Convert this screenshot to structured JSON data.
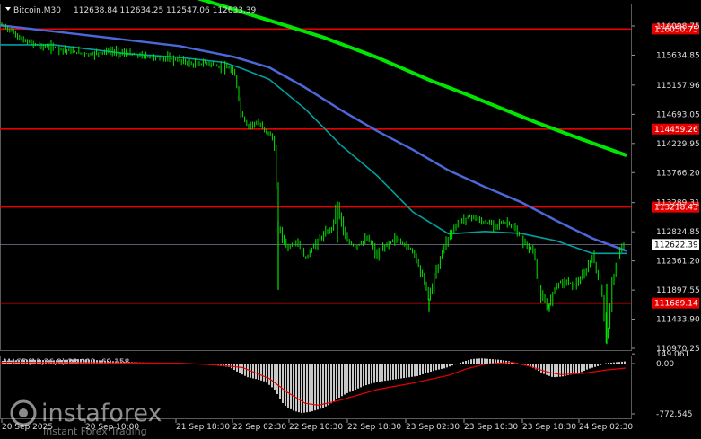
{
  "window": {
    "symbol_label": "Bitcoin,M30",
    "ohlc_label": "112638.84 112634.25 112547.06 112633.39"
  },
  "watermark": {
    "brand": "instaforex",
    "tagline": "Instant Forex Trading"
  },
  "chart_data": [
    {
      "type": "candlestick",
      "symbol": "Bitcoin",
      "timeframe": "M30",
      "y_ticks": [
        116098.75,
        115634.85,
        115157.96,
        114693.05,
        114229.95,
        113766.2,
        113289.31,
        112824.85,
        112361.2,
        111897.55,
        111433.9,
        110970.25
      ],
      "ylim": [
        110970.25,
        116230
      ],
      "x_ticks": [
        "20 Sep 2025",
        "20 Sep 10:00",
        "21 Sep 18:30",
        "22 Sep 02:30",
        "22 Sep 10:30",
        "22 Sep 18:30",
        "23 Sep 02:30",
        "23 Sep 10:30",
        "23 Sep 18:30",
        "24 Sep 02:30"
      ],
      "horizontal_levels": [
        {
          "label": "116050.75",
          "value": 116050.75,
          "color": "#e60000"
        },
        {
          "label": "114459.26",
          "value": 114459.26,
          "color": "#e60000"
        },
        {
          "label": "113218.43",
          "value": 113218.43,
          "color": "#e60000"
        },
        {
          "label": "111689.14",
          "value": 111689.14,
          "color": "#e60000"
        }
      ],
      "current_price": {
        "label": "112622.39",
        "value": 112622.39
      },
      "price_path": [
        [
          0,
          116120
        ],
        [
          10,
          116050
        ],
        [
          25,
          115870
        ],
        [
          45,
          115780
        ],
        [
          60,
          115760
        ],
        [
          80,
          115690
        ],
        [
          100,
          115650
        ],
        [
          120,
          115700
        ],
        [
          140,
          115660
        ],
        [
          160,
          115620
        ],
        [
          180,
          115590
        ],
        [
          200,
          115560
        ],
        [
          215,
          115480
        ],
        [
          230,
          115520
        ],
        [
          245,
          115440
        ],
        [
          255,
          115420
        ],
        [
          262,
          115300
        ],
        [
          268,
          114730
        ],
        [
          275,
          114510
        ],
        [
          285,
          114560
        ],
        [
          295,
          114450
        ],
        [
          305,
          114300
        ],
        [
          310,
          112890
        ],
        [
          320,
          112560
        ],
        [
          330,
          112680
        ],
        [
          340,
          112390
        ],
        [
          350,
          112620
        ],
        [
          360,
          112770
        ],
        [
          370,
          112890
        ],
        [
          375,
          113300
        ],
        [
          385,
          112700
        ],
        [
          395,
          112580
        ],
        [
          410,
          112720
        ],
        [
          420,
          112440
        ],
        [
          430,
          112610
        ],
        [
          440,
          112720
        ],
        [
          450,
          112620
        ],
        [
          460,
          112520
        ],
        [
          470,
          112140
        ],
        [
          478,
          111770
        ],
        [
          485,
          112160
        ],
        [
          495,
          112620
        ],
        [
          505,
          112880
        ],
        [
          515,
          113020
        ],
        [
          525,
          113080
        ],
        [
          535,
          112990
        ],
        [
          550,
          112940
        ],
        [
          565,
          112980
        ],
        [
          575,
          112830
        ],
        [
          585,
          112620
        ],
        [
          595,
          112510
        ],
        [
          600,
          111880
        ],
        [
          610,
          111610
        ],
        [
          620,
          112010
        ],
        [
          630,
          112030
        ],
        [
          640,
          111980
        ],
        [
          650,
          112120
        ],
        [
          660,
          112440
        ],
        [
          670,
          111900
        ],
        [
          676,
          111050
        ],
        [
          682,
          112030
        ],
        [
          690,
          112500
        ],
        [
          697,
          112633
        ]
      ],
      "series": [
        {
          "name": "",
          "color": "#00e600",
          "points": [
            [
              150,
              116850
            ],
            [
              320,
              116100
            ],
            [
              360,
              115920
            ],
            [
              420,
              115600
            ],
            [
              480,
              115230
            ],
            [
              520,
              115010
            ],
            [
              560,
              114780
            ],
            [
              600,
              114550
            ],
            [
              640,
              114340
            ],
            [
              698,
              114040
            ]
          ]
        },
        {
          "name": "",
          "color": "#4c68d8",
          "points": [
            [
              0,
              116110
            ],
            [
              80,
              115980
            ],
            [
              140,
              115880
            ],
            [
              200,
              115780
            ],
            [
              260,
              115610
            ],
            [
              300,
              115440
            ],
            [
              340,
              115120
            ],
            [
              380,
              114760
            ],
            [
              420,
              114430
            ],
            [
              460,
              114130
            ],
            [
              500,
              113800
            ],
            [
              540,
              113540
            ],
            [
              580,
              113300
            ],
            [
              620,
              113000
            ],
            [
              660,
              112720
            ],
            [
              698,
              112520
            ]
          ]
        },
        {
          "name": "",
          "color": "#00a0a0",
          "points": [
            [
              0,
              115800
            ],
            [
              60,
              115800
            ],
            [
              140,
              115660
            ],
            [
              200,
              115600
            ],
            [
              250,
              115520
            ],
            [
              270,
              115420
            ],
            [
              300,
              115250
            ],
            [
              340,
              114780
            ],
            [
              380,
              114200
            ],
            [
              420,
              113720
            ],
            [
              460,
              113140
            ],
            [
              500,
              112790
            ],
            [
              540,
              112830
            ],
            [
              580,
              112800
            ],
            [
              620,
              112680
            ],
            [
              660,
              112480
            ],
            [
              698,
              112480
            ]
          ]
        }
      ]
    },
    {
      "type": "bar",
      "indicator": "MACD",
      "label": "MACD(12,26,9) 33.012 -69.158",
      "y_ticks": [
        149.061,
        0.0,
        -772.545
      ],
      "ylim": [
        -900,
        200
      ],
      "histogram": [
        [
          0,
          40
        ],
        [
          30,
          60
        ],
        [
          60,
          50
        ],
        [
          90,
          70
        ],
        [
          120,
          40
        ],
        [
          150,
          20
        ],
        [
          180,
          10
        ],
        [
          200,
          5
        ],
        [
          220,
          -10
        ],
        [
          240,
          -30
        ],
        [
          255,
          -55
        ],
        [
          265,
          -140
        ],
        [
          275,
          -210
        ],
        [
          285,
          -240
        ],
        [
          295,
          -280
        ],
        [
          305,
          -400
        ],
        [
          315,
          -630
        ],
        [
          325,
          -720
        ],
        [
          335,
          -760
        ],
        [
          345,
          -740
        ],
        [
          355,
          -700
        ],
        [
          365,
          -640
        ],
        [
          375,
          -540
        ],
        [
          385,
          -460
        ],
        [
          395,
          -400
        ],
        [
          405,
          -340
        ],
        [
          415,
          -300
        ],
        [
          425,
          -270
        ],
        [
          435,
          -250
        ],
        [
          445,
          -230
        ],
        [
          455,
          -210
        ],
        [
          465,
          -190
        ],
        [
          475,
          -140
        ],
        [
          485,
          -100
        ],
        [
          495,
          -70
        ],
        [
          505,
          -20
        ],
        [
          515,
          30
        ],
        [
          525,
          70
        ],
        [
          535,
          80
        ],
        [
          545,
          70
        ],
        [
          555,
          60
        ],
        [
          565,
          40
        ],
        [
          575,
          10
        ],
        [
          585,
          -30
        ],
        [
          595,
          -80
        ],
        [
          605,
          -160
        ],
        [
          615,
          -210
        ],
        [
          625,
          -200
        ],
        [
          635,
          -170
        ],
        [
          645,
          -140
        ],
        [
          655,
          -80
        ],
        [
          665,
          -40
        ],
        [
          675,
          10
        ],
        [
          685,
          20
        ],
        [
          695,
          33
        ]
      ],
      "signal_line": [
        [
          0,
          20
        ],
        [
          200,
          5
        ],
        [
          240,
          -20
        ],
        [
          270,
          -60
        ],
        [
          300,
          -230
        ],
        [
          320,
          -440
        ],
        [
          340,
          -610
        ],
        [
          355,
          -640
        ],
        [
          380,
          -560
        ],
        [
          420,
          -400
        ],
        [
          460,
          -300
        ],
        [
          500,
          -180
        ],
        [
          520,
          -80
        ],
        [
          540,
          -10
        ],
        [
          570,
          20
        ],
        [
          590,
          -40
        ],
        [
          610,
          -130
        ],
        [
          625,
          -170
        ],
        [
          650,
          -150
        ],
        [
          675,
          -100
        ],
        [
          697,
          -69
        ]
      ]
    }
  ]
}
